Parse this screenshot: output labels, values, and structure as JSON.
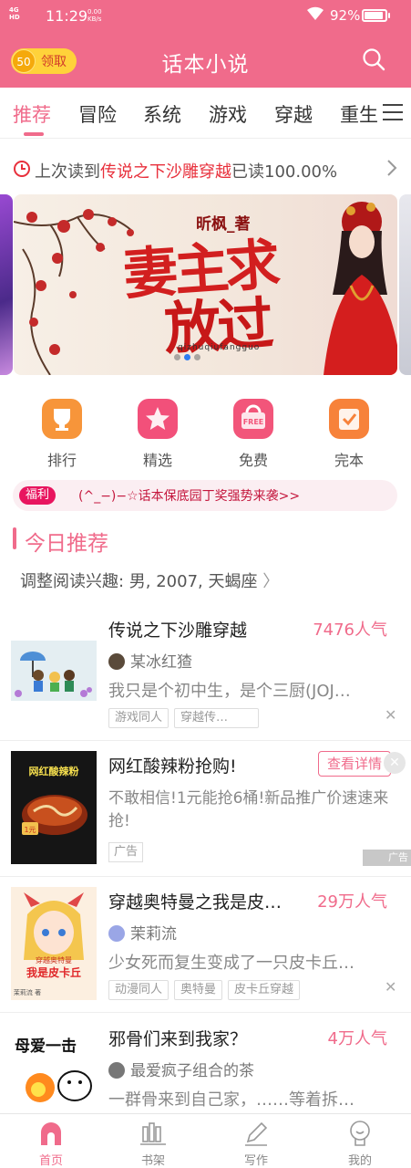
{
  "status_bar": {
    "signal": "4G",
    "signal_sub": "HD",
    "time": "11:29",
    "speed_value": "0.00",
    "speed_unit": "KB/s",
    "battery": "92%"
  },
  "header": {
    "coin_count": "50",
    "coin_label": "领取",
    "title": "话本小说"
  },
  "tabs": [
    "推荐",
    "冒险",
    "系统",
    "游戏",
    "穿越",
    "重生"
  ],
  "active_tab": 0,
  "last_read": {
    "prefix": "上次读到",
    "book": "传说之下沙雕穿越",
    "suffix": "已读100.00%"
  },
  "banner": {
    "author": "昕枫_著",
    "title_line1": "妻主求",
    "title_line2": "放过",
    "pinyin": "qizhuqiufangguo"
  },
  "quick_links": [
    {
      "label": "排行",
      "icon": "trophy-icon",
      "color": "#f7953a"
    },
    {
      "label": "精选",
      "icon": "star-icon",
      "color": "#f2507a"
    },
    {
      "label": "免费",
      "icon": "free-icon",
      "color": "#f2557a"
    },
    {
      "label": "完本",
      "icon": "checkbook-icon",
      "color": "#f7823a"
    }
  ],
  "notice": {
    "tag": "福利",
    "message": "(^_−)−☆话本保底园丁奖强势来袭>>"
  },
  "section": {
    "title": "今日推荐",
    "interest": "调整阅读兴趣: 男, 2007, 天蝎座"
  },
  "books": [
    {
      "title": "传说之下沙雕穿越",
      "popularity": "7476人气",
      "author": "某冰红猹",
      "desc": "我只是个初中生，是个三厨(JOJ…",
      "tags": [
        "游戏同人",
        "穿越传…"
      ]
    },
    {
      "title": "穿越奥特曼之我是皮…",
      "popularity": "29万人气",
      "author": "茉莉流",
      "desc": "少女死而复生变成了一只皮卡丘…",
      "tags": [
        "动漫同人",
        "奥特曼",
        "皮卡丘穿越"
      ]
    },
    {
      "title": "邪骨们来到我家？",
      "popularity": "4万人气",
      "author": "最爱疯子组合的茶",
      "desc": "一群骨来到自己家，……等着拆…",
      "tags": []
    }
  ],
  "ad": {
    "title": "网红酸辣粉抢购!",
    "detail_button": "查看详情",
    "desc": "不敢相信!1元能抢6桶!新品推广价速速来抢!",
    "tag": "广告",
    "logo_text": "广告"
  },
  "covers": {
    "book3_text": "母爱一击",
    "book2_cover_title": "我是皮卡丘",
    "book2_cover_sub": "穿越奥特曼",
    "book2_cover_author": "茉莉流 著",
    "ad_cover_text": "网红酸辣粉"
  },
  "bottom_nav": [
    {
      "label": "首页",
      "icon": "home-icon"
    },
    {
      "label": "书架",
      "icon": "bookshelf-icon"
    },
    {
      "label": "写作",
      "icon": "pen-icon"
    },
    {
      "label": "我的",
      "icon": "profile-icon"
    }
  ],
  "colors": {
    "brand": "#f06b8b",
    "highlight": "#e8303c"
  }
}
